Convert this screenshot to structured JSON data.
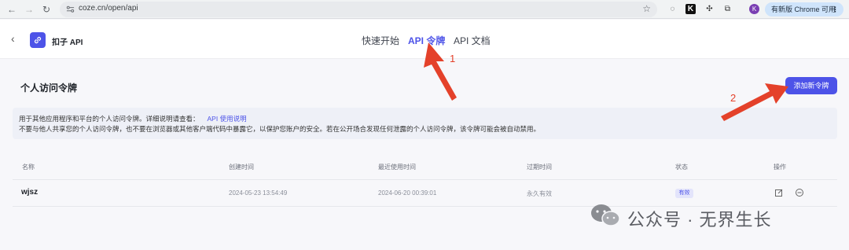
{
  "browser": {
    "url": "coze.cn/open/api",
    "update_label": "有新版 Chrome 可用",
    "profile_initial": "K"
  },
  "header": {
    "app_title": "扣子 API",
    "tabs": [
      {
        "label": "快速开始",
        "active": false
      },
      {
        "label": "API 令牌",
        "active": true
      },
      {
        "label": "API 文档",
        "active": false
      }
    ]
  },
  "page": {
    "section_title": "个人访问令牌",
    "add_button": "添加新令牌",
    "info_line1": "用于其他应用程序和平台的个人访问令牌。详细说明请查看：",
    "info_link": "API 使用说明",
    "info_line2": "不要与他人共享您的个人访问令牌，也不要在浏览器或其他客户端代码中暴露它，以保护您账户的安全。若在公开场合发现任何泄露的个人访问令牌，该令牌可能会被自动禁用。"
  },
  "table": {
    "columns": [
      "名称",
      "创建时间",
      "最近使用时间",
      "过期时间",
      "状态",
      "操作"
    ],
    "rows": [
      {
        "name": "wjsz",
        "created": "2024-05-23 13:54:49",
        "last_used": "2024-06-20 00:39:01",
        "expires": "永久有效",
        "status": "有效"
      }
    ]
  },
  "annotations": {
    "num1": "1",
    "num2": "2",
    "color": "#e4412a"
  },
  "watermark": {
    "text": "公众号 · 无界生长"
  },
  "colors": {
    "accent": "#4d53e8"
  }
}
